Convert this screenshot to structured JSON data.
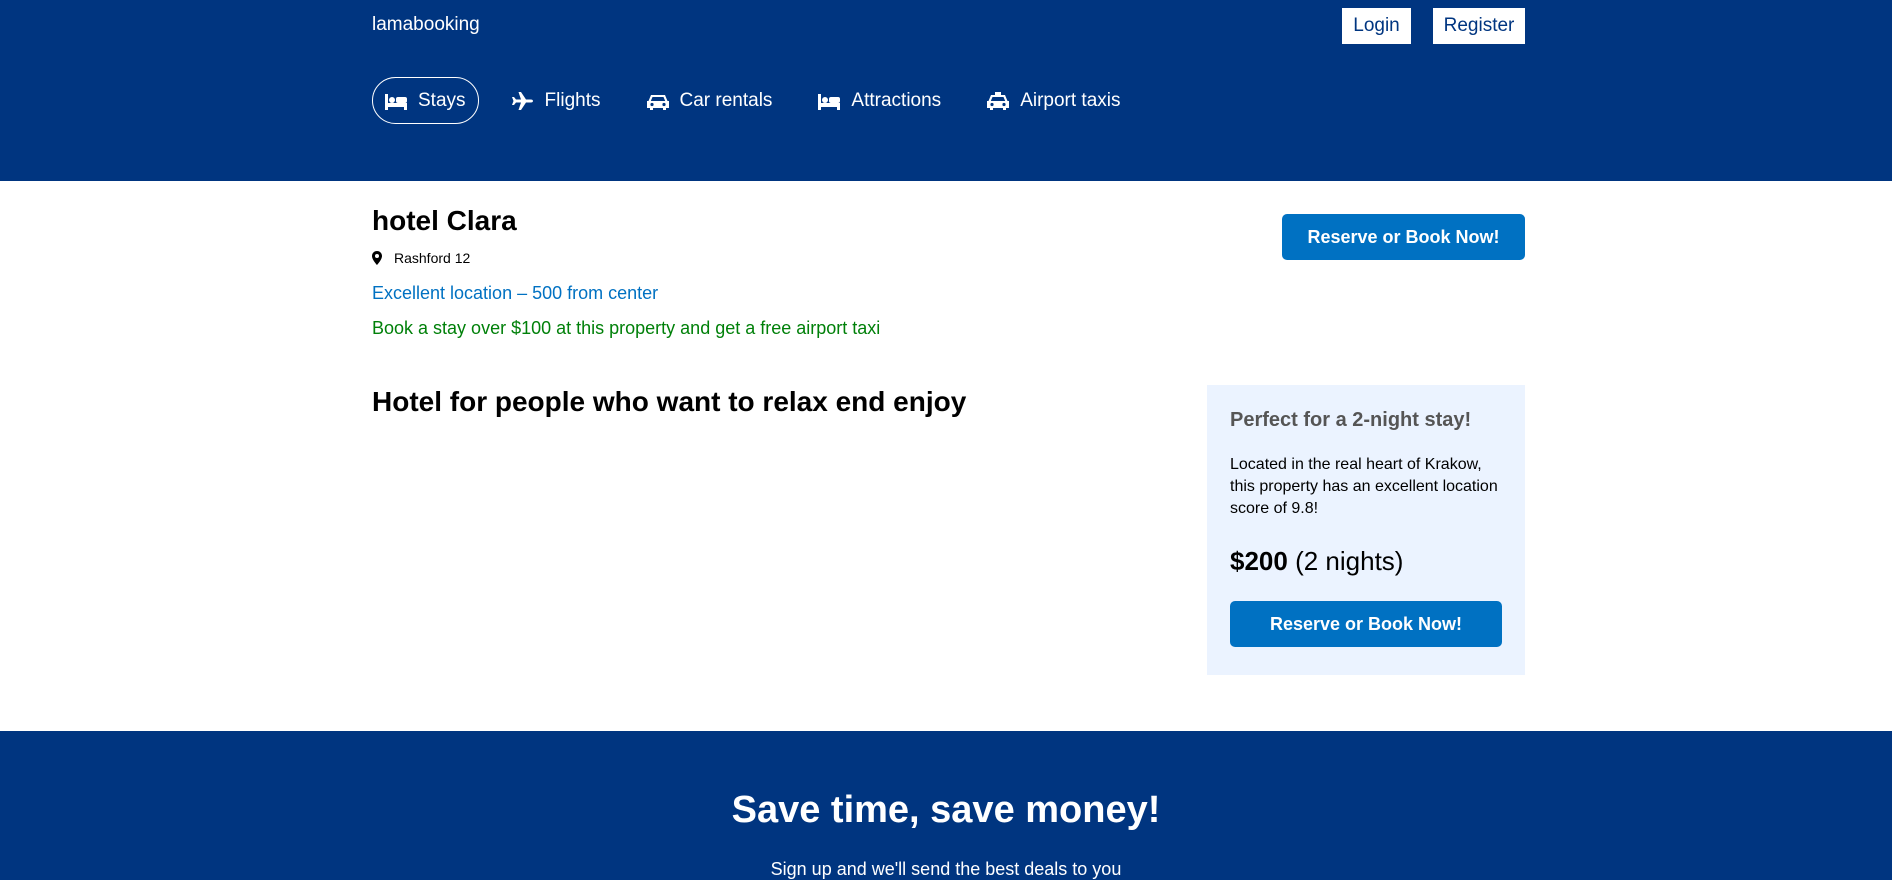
{
  "header": {
    "logo": "lamabooking",
    "login_label": "Login",
    "register_label": "Register",
    "tabs": [
      {
        "label": "Stays",
        "icon": "bed-icon",
        "active": true
      },
      {
        "label": "Flights",
        "icon": "plane-icon",
        "active": false
      },
      {
        "label": "Car rentals",
        "icon": "car-icon",
        "active": false
      },
      {
        "label": "Attractions",
        "icon": "bed-icon",
        "active": false
      },
      {
        "label": "Airport taxis",
        "icon": "taxi-icon",
        "active": false
      }
    ]
  },
  "hotel": {
    "title": "hotel Clara",
    "address": "Rashford 12",
    "distance": "Excellent location – 500 from center",
    "highlight": "Book a stay over $100 at this property and get a free airport taxi",
    "reserve_label": "Reserve or Book Now!",
    "description_title": "Hotel for people who want to relax end enjoy"
  },
  "price_box": {
    "title": "Perfect for a 2-night stay!",
    "text": "Located in the real heart of Krakow, this property has an excellent location score of 9.8!",
    "price": "$200",
    "nights": "(2 nights)",
    "reserve_label": "Reserve or Book Now!"
  },
  "footer": {
    "title": "Save time, save money!",
    "subtitle": "Sign up and we'll send the best deals to you"
  },
  "colors": {
    "brand": "#003580",
    "accent": "#0071c2",
    "success": "#008009",
    "box_bg": "#ebf3ff"
  }
}
